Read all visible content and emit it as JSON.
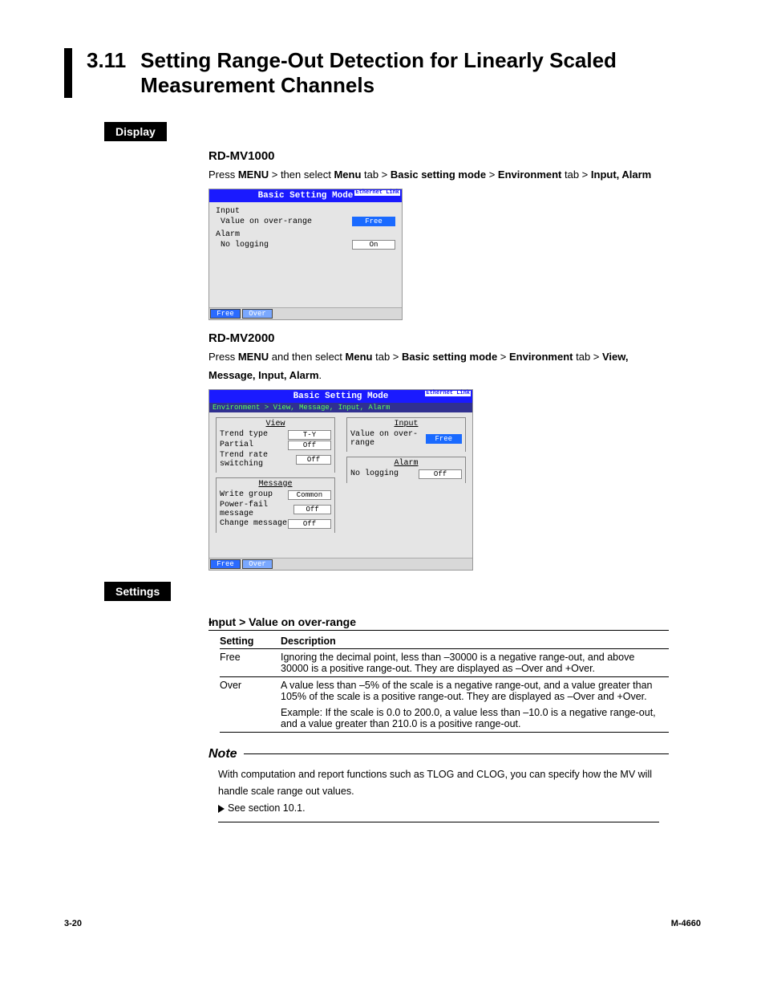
{
  "section": {
    "num": "3.11",
    "title": "Setting Range-Out Detection for Linearly Scaled Measurement Channels"
  },
  "headers": {
    "display": "Display",
    "settings": "Settings"
  },
  "mv1000": {
    "model": "RD-MV1000",
    "path_pre": "Press ",
    "path_b1": "MENU",
    "path_mid1": " > then select ",
    "path_b2": "Menu",
    "path_mid2": " tab > ",
    "path_b3": "Basic setting mode",
    "path_mid3": " > ",
    "path_b4": "Environment",
    "path_mid4": " tab > ",
    "path_b5": "Input, Alarm",
    "screen": {
      "title": "Basic Setting Mode",
      "eth": "Ethernet Link",
      "input_hdr": "Input",
      "r1_label": "Value on over-range",
      "r1_val": "Free",
      "alarm_hdr": "Alarm",
      "r2_label": "No logging",
      "r2_val": "On",
      "btn1": "Free",
      "btn2": "Over"
    }
  },
  "mv2000": {
    "model": "RD-MV2000",
    "path_pre": "Press ",
    "path_b1": "MENU",
    "path_mid1": " and then select ",
    "path_b2": "Menu",
    "path_mid2": " tab > ",
    "path_b3": "Basic setting mode",
    "path_mid3": " > ",
    "path_b4": "Environment",
    "path_mid4": " tab > ",
    "path_b5": "View, Message, Input, Alarm",
    "path_end": ".",
    "screen": {
      "title": "Basic Setting Mode",
      "eth": "Ethernet Link",
      "crumb": "Environment > View, Message, Input, Alarm",
      "view": "View",
      "v1l": "Trend type",
      "v1v": "T-Y",
      "v2l": "Partial",
      "v2v": "Off",
      "v3l": "Trend rate switching",
      "v3v": "Off",
      "msg": "Message",
      "m1l": "Write group",
      "m1v": "Common",
      "m2l": "Power-fail message",
      "m2v": "Off",
      "m3l": "Change message",
      "m3v": "Off",
      "input": "Input",
      "i1l": "Value on over-range",
      "i1v": "Free",
      "alarm": "Alarm",
      "a1l": "No logging",
      "a1v": "Off",
      "btn1": "Free",
      "btn2": "Over"
    }
  },
  "settings_block": {
    "bullet": "Input > Value on over-range",
    "th1": "Setting",
    "th2": "Description",
    "r1c1": "Free",
    "r1c2": "Ignoring the decimal point, less than –30000 is a negative range-out, and above 30000 is a positive range-out. They are displayed as –Over and +Over.",
    "r2c1": "Over",
    "r2c2": "A value less than –5% of the scale is a negative range-out, and a value greater than 105% of the scale is a positive range-out. They are displayed as –Over and +Over.",
    "r2c2b": "Example: If the scale is 0.0 to 200.0, a value less than –10.0 is a negative range-out, and a value greater than 210.0 is a positive range-out."
  },
  "note": {
    "head": "Note",
    "body": "With computation and report functions such as TLOG and CLOG, you can specify how the MV will handle scale range out values.",
    "see": "See section 10.1."
  },
  "footer": {
    "left": "3-20",
    "right": "M-4660"
  }
}
